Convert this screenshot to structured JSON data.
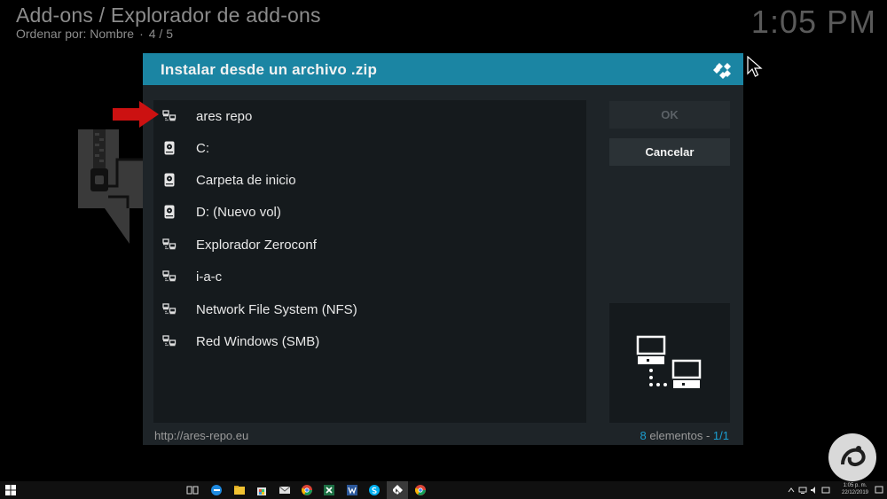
{
  "header": {
    "breadcrumb": "Add-ons / Explorador de add-ons",
    "sort_label": "Ordenar por: Nombre",
    "sort_sep": "·",
    "position": "4 / 5",
    "clock": "1:05 PM"
  },
  "dialog": {
    "title": "Instalar desde un archivo .zip",
    "items": [
      {
        "label": "ares repo",
        "icon": "network-icon"
      },
      {
        "label": "C:",
        "icon": "hard-drive-icon"
      },
      {
        "label": "Carpeta de inicio",
        "icon": "hard-drive-icon"
      },
      {
        "label": "D: (Nuevo vol)",
        "icon": "hard-drive-icon"
      },
      {
        "label": "Explorador Zeroconf",
        "icon": "network-icon"
      },
      {
        "label": "i-a-c",
        "icon": "network-icon"
      },
      {
        "label": "Network File System (NFS)",
        "icon": "network-icon"
      },
      {
        "label": "Red Windows (SMB)",
        "icon": "network-icon"
      }
    ],
    "ok_label": "OK",
    "cancel_label": "Cancelar",
    "footer_path": "http://ares-repo.eu",
    "footer_count_num": "8",
    "footer_count_text": " elementos - ",
    "footer_page": "1/1"
  },
  "taskbar": {
    "time": "1:05 p. m.",
    "date": "22/12/2019"
  },
  "colors": {
    "accent": "#1b85a3",
    "dialog_bg": "#1e2428",
    "annotation_arrow": "#cc1111"
  }
}
